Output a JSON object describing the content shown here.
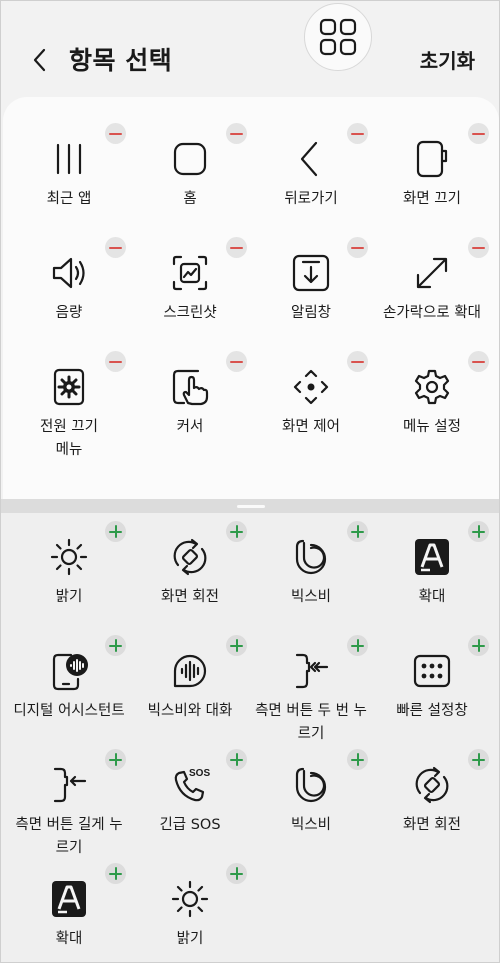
{
  "header": {
    "title": "항목 선택",
    "reset_label": "초기화"
  },
  "selected": [
    {
      "name": "recent-apps",
      "label": "최근 앱",
      "icon": "recent-apps-icon"
    },
    {
      "name": "home",
      "label": "홈",
      "icon": "home-icon"
    },
    {
      "name": "back",
      "label": "뒤로가기",
      "icon": "back-arrow-icon"
    },
    {
      "name": "screen-off",
      "label": "화면 끄기",
      "icon": "screen-off-icon"
    },
    {
      "name": "volume",
      "label": "음량",
      "icon": "volume-icon"
    },
    {
      "name": "screenshot",
      "label": "스크린샷",
      "icon": "screenshot-icon"
    },
    {
      "name": "notification-panel",
      "label": "알림창",
      "icon": "notification-panel-icon"
    },
    {
      "name": "pinch-zoom",
      "label": "손가락으로 확대",
      "icon": "pinch-zoom-icon"
    },
    {
      "name": "power-off-menu",
      "label": "전원 끄기 메뉴",
      "icon": "power-menu-icon"
    },
    {
      "name": "cursor",
      "label": "커서",
      "icon": "cursor-hand-icon"
    },
    {
      "name": "screen-control",
      "label": "화면 제어",
      "icon": "screen-control-icon"
    },
    {
      "name": "menu-settings",
      "label": "메뉴 설정",
      "icon": "gear-icon"
    }
  ],
  "available": [
    {
      "name": "brightness",
      "label": "밝기",
      "icon": "brightness-icon"
    },
    {
      "name": "rotate-screen",
      "label": "화면 회전",
      "icon": "rotate-icon"
    },
    {
      "name": "bixby",
      "label": "빅스비",
      "icon": "bixby-icon"
    },
    {
      "name": "magnify",
      "label": "확대",
      "icon": "magnify-icon"
    },
    {
      "name": "digital-assistant",
      "label": "디지털 어시스턴트",
      "icon": "assistant-icon"
    },
    {
      "name": "bixby-chat",
      "label": "빅스비와 대화",
      "icon": "bixby-voice-icon"
    },
    {
      "name": "side-double-press",
      "label": "측면 버튼 두 번 누르기",
      "icon": "side-button-icon"
    },
    {
      "name": "quick-settings",
      "label": "빠른 설정창",
      "icon": "quick-settings-icon"
    },
    {
      "name": "side-long-press",
      "label": "측면 버튼 길게 누르기",
      "icon": "side-button-icon"
    },
    {
      "name": "emergency-sos",
      "label": "긴급 SOS",
      "icon": "sos-phone-icon"
    },
    {
      "name": "bixby-2",
      "label": "빅스비",
      "icon": "bixby-icon"
    },
    {
      "name": "rotate-screen-2",
      "label": "화면 회전",
      "icon": "rotate-icon"
    },
    {
      "name": "magnify-2",
      "label": "확대",
      "icon": "magnify-icon"
    },
    {
      "name": "brightness-2",
      "label": "밝기",
      "icon": "brightness-icon"
    }
  ],
  "sos_text": "SOS"
}
